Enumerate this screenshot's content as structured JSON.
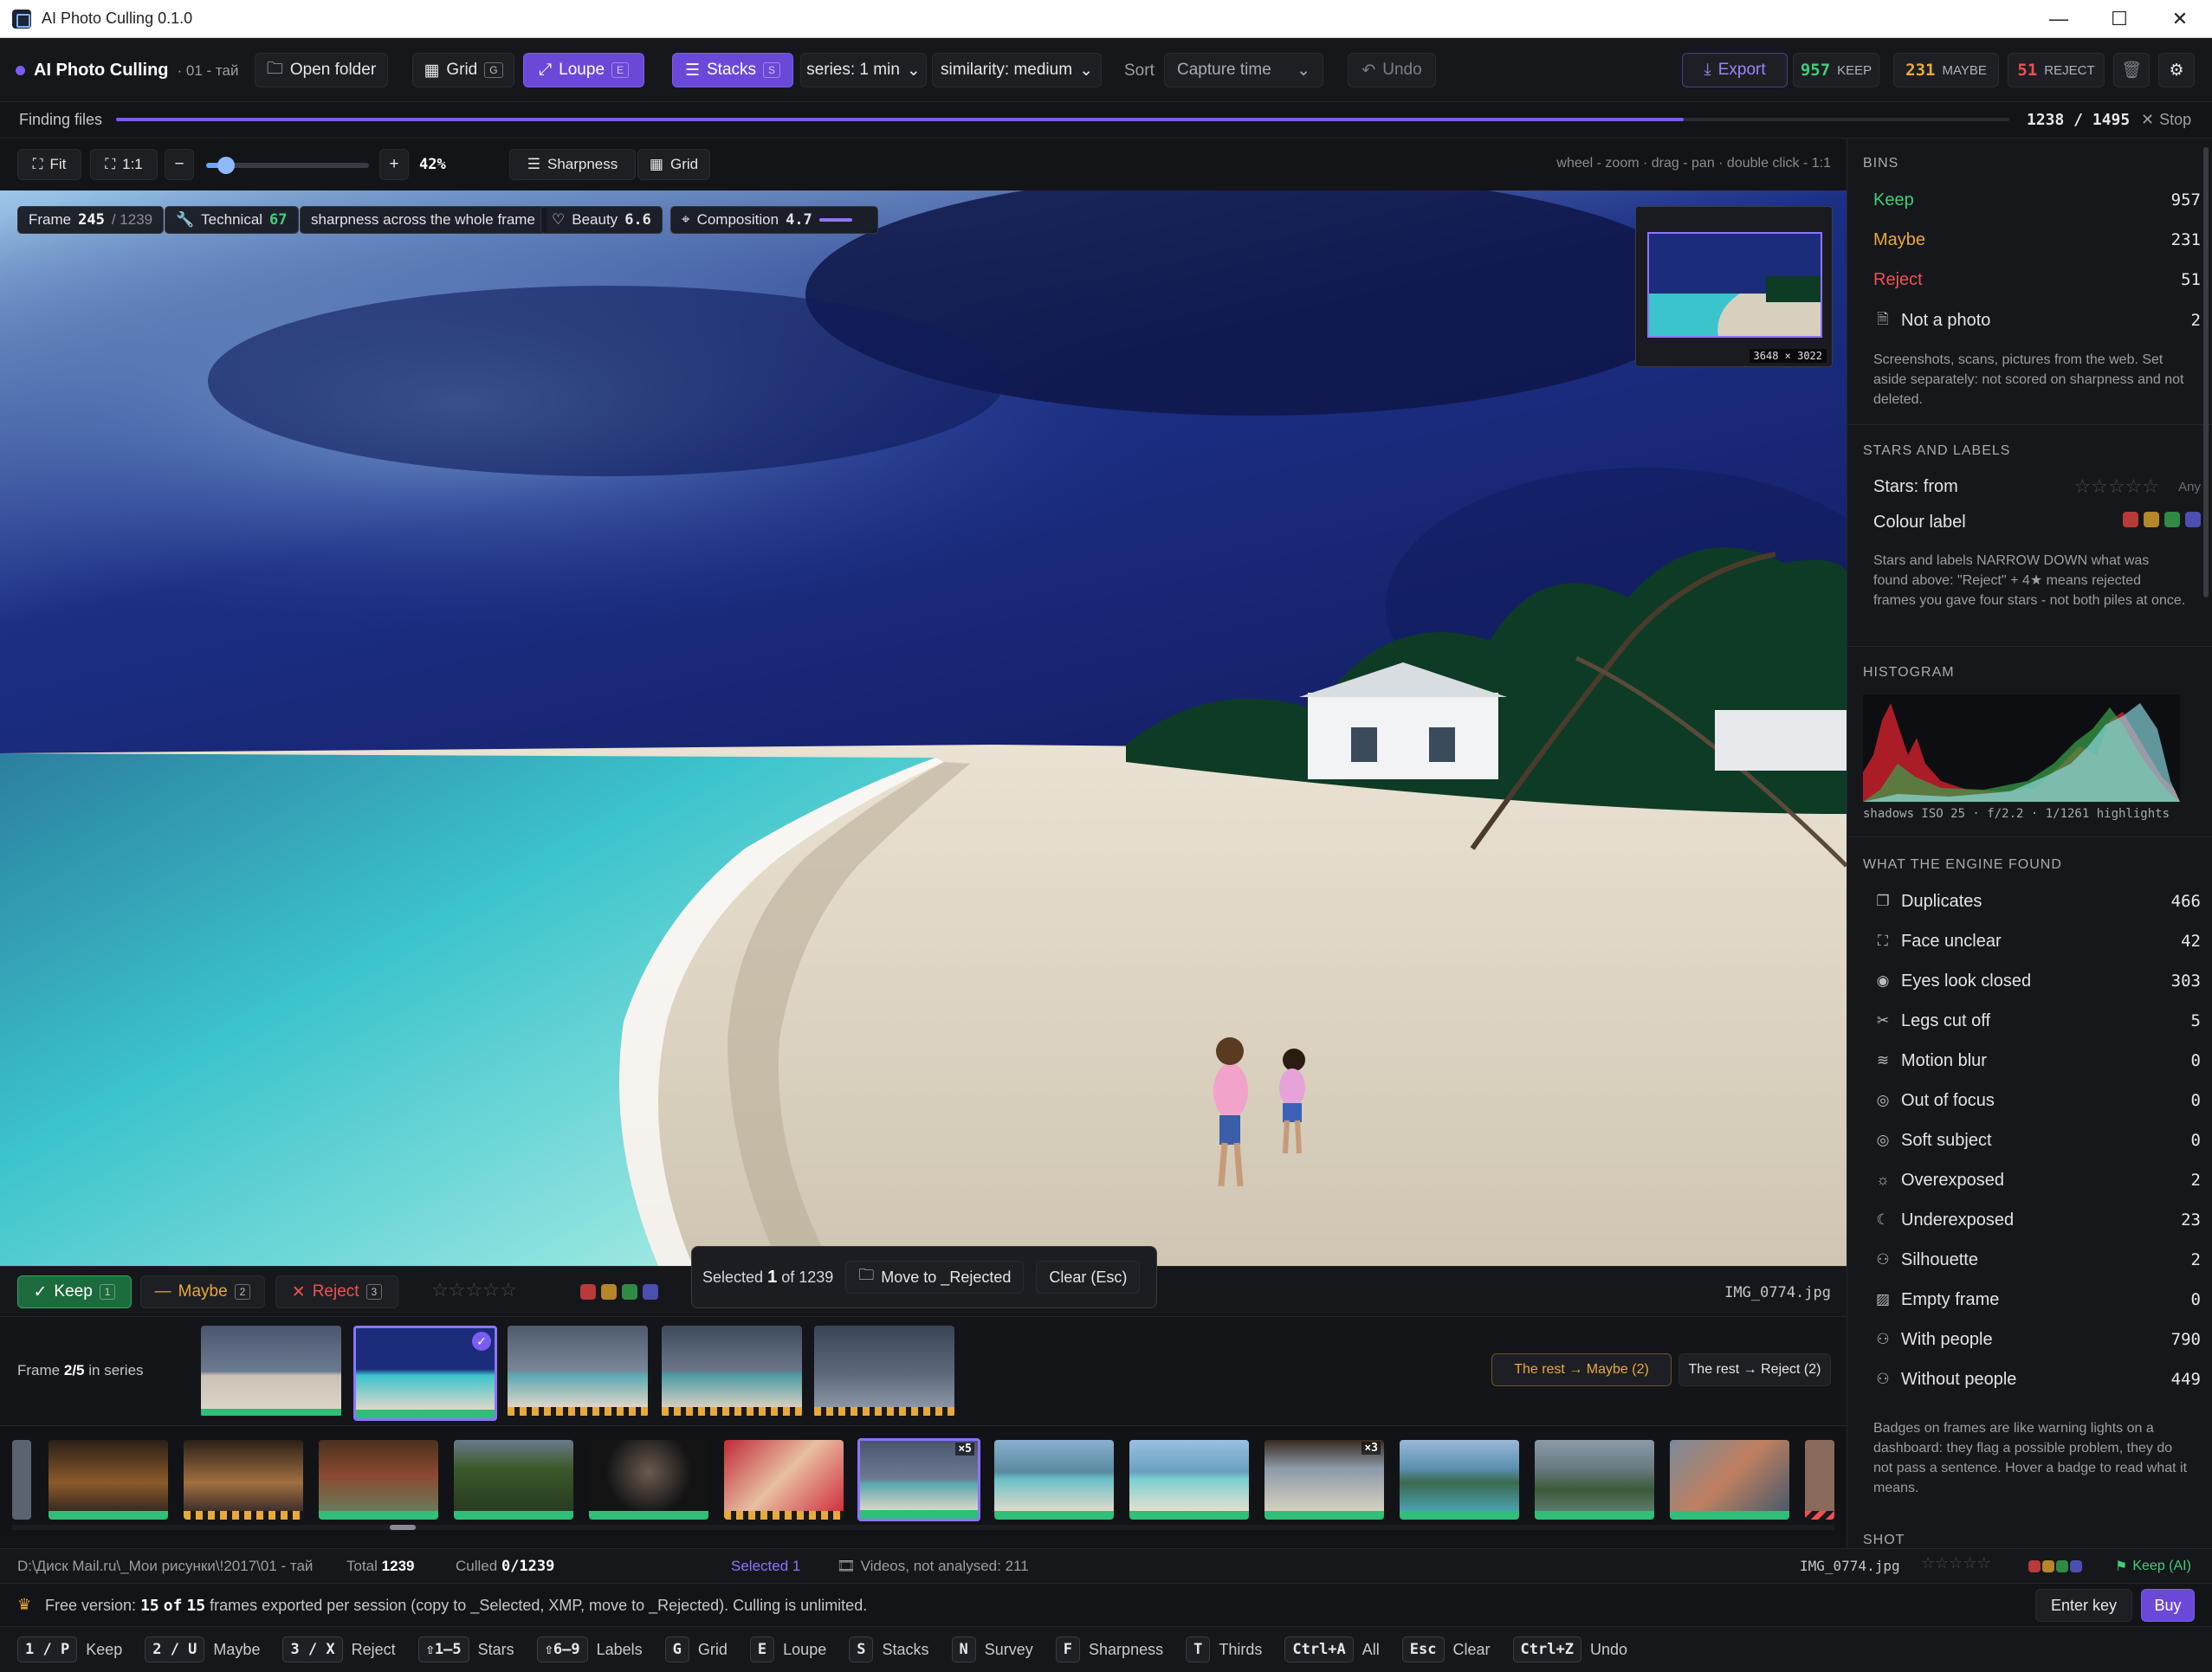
{
  "window": {
    "title": "AI Photo Culling 0.1.0"
  },
  "toolbar": {
    "app_name": "AI Photo Culling",
    "folder_sub": "· 01 - тай",
    "open_folder": "Open folder",
    "grid": "Grid",
    "grid_key": "G",
    "loupe": "Loupe",
    "loupe_key": "E",
    "stacks": "Stacks",
    "stacks_key": "S",
    "series": "series: 1 min",
    "similarity": "similarity: medium",
    "sort_label": "Sort",
    "sort_value": "Capture time",
    "undo": "Undo",
    "export": "Export",
    "keep_count": "957",
    "keep_label": "KEEP",
    "maybe_count": "231",
    "maybe_label": "MAYBE",
    "reject_count": "51",
    "reject_label": "REJECT"
  },
  "progress": {
    "label": "Finding files",
    "done": 1238,
    "total": 1495,
    "counter": "1238 / 1495",
    "stop": "Stop",
    "fraction": 0.828
  },
  "viewbar": {
    "fit": "Fit",
    "one_to_one": "1:1",
    "zoom": "42%",
    "zoom_fraction": 0.12,
    "sharpness": "Sharpness",
    "grid": "Grid",
    "hint": "wheel - zoom · drag - pan · double click - 1:1"
  },
  "photo": {
    "frame_label": "Frame",
    "frame_num": "245",
    "frame_total": "/ 1239",
    "technical_label": "Technical",
    "technical_val": "67",
    "sharp_note": "sharpness across the whole frame",
    "beauty_label": "Beauty",
    "beauty_val": "6.6",
    "composition_label": "Composition",
    "composition_val": "4.7",
    "dims": "3648 × 3022"
  },
  "sidebar": {
    "bins_title": "BINS",
    "bins": [
      {
        "label": "Keep",
        "count": "957",
        "color": "#3ecf7a"
      },
      {
        "label": "Maybe",
        "count": "231",
        "color": "#e9a93a"
      },
      {
        "label": "Reject",
        "count": "51",
        "color": "#ef5151"
      },
      {
        "label": "Not a photo",
        "count": "2",
        "color": "#e4e4e8"
      }
    ],
    "bins_note": "Screenshots, scans, pictures from the web. Set aside separately: not scored on sharpness and not deleted.",
    "stars_title": "STARS AND LABELS",
    "stars_from": "Stars: from",
    "stars_any": "Any",
    "colour_label": "Colour label",
    "stars_note": "Stars and labels NARROW DOWN what was found above: \"Reject\" + 4★ means rejected frames you gave four stars - not both piles at once.",
    "hist_title": "HISTOGRAM",
    "hist_caption": "shadows ISO 25 · f/2.2 · 1/1261 highlights",
    "engine_title": "WHAT THE ENGINE FOUND",
    "engine": [
      {
        "label": "Duplicates",
        "count": "466",
        "icon": "❐"
      },
      {
        "label": "Face unclear",
        "count": "42",
        "icon": "⛶"
      },
      {
        "label": "Eyes look closed",
        "count": "303",
        "icon": "◉"
      },
      {
        "label": "Legs cut off",
        "count": "5",
        "icon": "✂"
      },
      {
        "label": "Motion blur",
        "count": "0",
        "icon": "≋"
      },
      {
        "label": "Out of focus",
        "count": "0",
        "icon": "◎"
      },
      {
        "label": "Soft subject",
        "count": "0",
        "icon": "◎"
      },
      {
        "label": "Overexposed",
        "count": "2",
        "icon": "☼"
      },
      {
        "label": "Underexposed",
        "count": "23",
        "icon": "☾"
      },
      {
        "label": "Silhouette",
        "count": "2",
        "icon": "⚇"
      },
      {
        "label": "Empty frame",
        "count": "0",
        "icon": "▨"
      },
      {
        "label": "With people",
        "count": "790",
        "icon": "⚇"
      },
      {
        "label": "Without people",
        "count": "449",
        "icon": "⚇"
      }
    ],
    "engine_note": "Badges on frames are like warning lights on a dashboard: they flag a possible problem, they do not pass a sentence. Hover a badge to read what it means.",
    "shot_title": "SHOT"
  },
  "action": {
    "keep": "Keep",
    "keep_key": "1",
    "maybe": "Maybe",
    "maybe_key": "2",
    "reject": "Reject",
    "reject_key": "3",
    "selected_prefix": "Selected",
    "selected_num": "1",
    "selected_suffix": "of 1239",
    "move": "Move to _Rejected",
    "clear": "Clear (Esc)",
    "filename": "IMG_0774.jpg"
  },
  "series": {
    "frame_prefix": "Frame",
    "frame_pos": "2/5",
    "frame_suffix": "in series",
    "rest_maybe": "The rest → Maybe (2)",
    "rest_reject": "The rest → Reject (2)"
  },
  "strip": {
    "badge1": "×5",
    "badge2": "×3"
  },
  "status": {
    "path": "D:\\Диск Mail.ru\\_Мои рисунки\\!2017\\01 - тай",
    "total_label": "Total",
    "total": "1239",
    "culled_label": "Culled",
    "culled": "0/1239",
    "selected": "Selected 1",
    "videos": "Videos, not analysed: 211",
    "filename": "IMG_0774.jpg",
    "keep_ai": "Keep (AI)"
  },
  "promo": {
    "prefix": "Free version:",
    "used": "15",
    "of": "of",
    "limit": "15",
    "text": "frames exported per session (copy to _Selected, XMP, move to _Rejected). Culling is unlimited.",
    "enter_key": "Enter key",
    "buy": "Buy"
  },
  "shortcuts": [
    {
      "key": "1 / P",
      "label": "Keep"
    },
    {
      "key": "2 / U",
      "label": "Maybe"
    },
    {
      "key": "3 / X",
      "label": "Reject"
    },
    {
      "key": "⇧1–5",
      "label": "Stars"
    },
    {
      "key": "⇧6–9",
      "label": "Labels"
    },
    {
      "key": "G",
      "label": "Grid"
    },
    {
      "key": "E",
      "label": "Loupe"
    },
    {
      "key": "S",
      "label": "Stacks"
    },
    {
      "key": "N",
      "label": "Survey"
    },
    {
      "key": "F",
      "label": "Sharpness"
    },
    {
      "key": "T",
      "label": "Thirds"
    },
    {
      "key": "Ctrl+A",
      "label": "All"
    },
    {
      "key": "Esc",
      "label": "Clear"
    },
    {
      "key": "Ctrl+Z",
      "label": "Undo"
    }
  ],
  "colors": {
    "accent": "#6b49d8",
    "keep": "#3ecf7a",
    "maybe": "#e9a93a",
    "reject": "#ef5151"
  }
}
